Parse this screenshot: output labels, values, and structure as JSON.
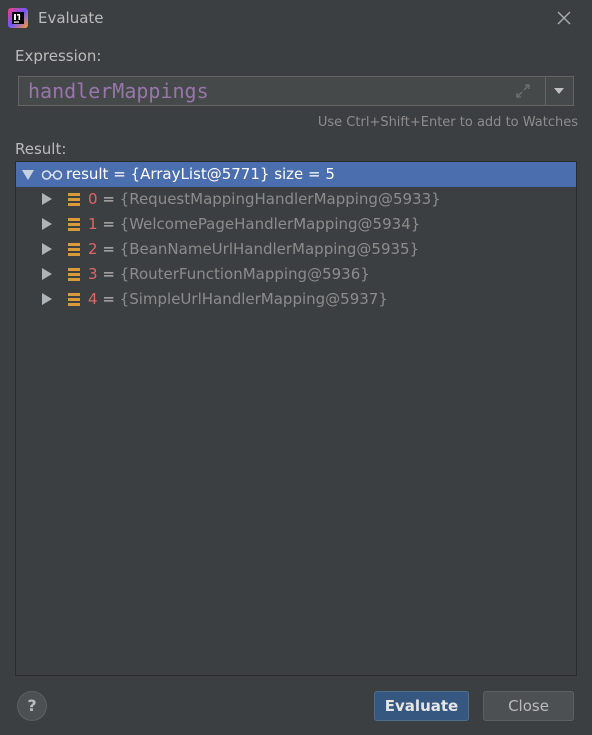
{
  "window": {
    "title": "Evaluate"
  },
  "expression": {
    "label": "Expression:",
    "value": "handlerMappings"
  },
  "hint": "Use Ctrl+Shift+Enter to add to Watches",
  "result": {
    "label": "Result:",
    "root": "result = {ArrayList@5771}  size = 5",
    "items": [
      {
        "index": "0",
        "eq": " = ",
        "value": "{RequestMappingHandlerMapping@5933}"
      },
      {
        "index": "1",
        "eq": " = ",
        "value": "{WelcomePageHandlerMapping@5934}"
      },
      {
        "index": "2",
        "eq": " = ",
        "value": "{BeanNameUrlHandlerMapping@5935}"
      },
      {
        "index": "3",
        "eq": " = ",
        "value": "{RouterFunctionMapping@5936}"
      },
      {
        "index": "4",
        "eq": " = ",
        "value": "{SimpleUrlHandlerMapping@5937}"
      }
    ]
  },
  "buttons": {
    "help": "?",
    "evaluate": "Evaluate",
    "close": "Close"
  },
  "icons": {
    "app": "intellij-idea-icon",
    "close": "close-icon",
    "expand": "expand-icon",
    "dropdown": "chevron-down-icon",
    "watch": "watch-glasses-icon",
    "field": "field-icon"
  },
  "colors": {
    "background": "#3c3f41",
    "selection": "#4b6eaf",
    "expression": "#9876aa",
    "index": "#e06666",
    "primary_button": "#365880"
  }
}
